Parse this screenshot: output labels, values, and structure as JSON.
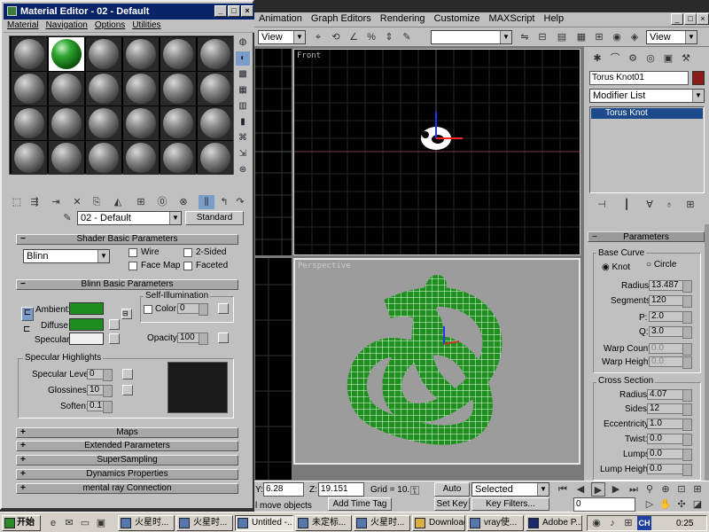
{
  "material_editor": {
    "title": "Material Editor - 02 - Default",
    "menu": [
      "Material",
      "Navigation",
      "Options",
      "Utilities"
    ],
    "material_name": "02 - Default",
    "material_type": "Standard",
    "shader_rollout": "Shader Basic Parameters",
    "shader": "Blinn",
    "wire_label": "Wire",
    "two_sided_label": "2-Sided",
    "face_map_label": "Face Map",
    "faceted_label": "Faceted",
    "blinn_rollout": "Blinn Basic Parameters",
    "self_illum_title": "Self-Illumination",
    "color_label": "Color",
    "color_value": "0",
    "ambient_label": "Ambient:",
    "diffuse_label": "Diffuse:",
    "specular_label": "Specular:",
    "opacity_label": "Opacity:",
    "opacity_value": "100",
    "spec_highlights_title": "Specular Highlights",
    "spec_level_label": "Specular Level:",
    "spec_level_value": "0",
    "glossiness_label": "Glossiness:",
    "glossiness_value": "10",
    "soften_label": "Soften:",
    "soften_value": "0.1",
    "collapsed_rollouts": [
      "Maps",
      "Extended Parameters",
      "SuperSampling",
      "Dynamics Properties",
      "mental ray Connection"
    ],
    "colors": {
      "ambient": "#1e8c1e",
      "diffuse": "#1e8c1e",
      "specular": "#f0f0f0"
    }
  },
  "max": {
    "menu": [
      "Animation",
      "Graph Editors",
      "Rendering",
      "Customize",
      "MAXScript",
      "Help"
    ],
    "view_dropdown_left": "View",
    "view_dropdown_right": "View",
    "viewport_front_label": "Front",
    "viewport_persp_label": "Perspective",
    "object_name": "Torus Knot01",
    "modifier_list": "Modifier List",
    "modifier_stack_item": "Torus Knot",
    "params_rollout": "Parameters",
    "base_curve_title": "Base Curve",
    "knot_label": "Knot",
    "circle_label": "Circle",
    "radius_label": "Radius:",
    "radius_value": "13.487",
    "segments_label": "Segments:",
    "segments_value": "120",
    "p_label": "P:",
    "p_value": "2.0",
    "q_label": "Q:",
    "q_value": "3.0",
    "warp_count_label": "Warp Count:",
    "warp_count_value": "0.0",
    "warp_height_label": "Warp Height:",
    "warp_height_value": "0.0",
    "cross_section_title": "Cross Section",
    "cs_radius_label": "Radius:",
    "cs_radius_value": "4.07",
    "sides_label": "Sides:",
    "sides_value": "12",
    "eccentricity_label": "Eccentricity:",
    "eccentricity_value": "1.0",
    "twist_label": "Twist:",
    "twist_value": "0.0",
    "lumps_label": "Lumps:",
    "lumps_value": "0.0",
    "lump_height_label": "Lump Height:",
    "lump_height_value": "0.0",
    "object_color": "#8b1a1a"
  },
  "status": {
    "y_label": "Y:",
    "y_value": "6.28",
    "z_label": "Z:",
    "z_value": "19.151",
    "grid_label": "Grid = 10.",
    "auto_key": "Auto Key",
    "selected": "Selected",
    "set_key": "Set Key",
    "key_filters": "Key Filters...",
    "add_time_tag": "Add Time Tag",
    "prompt": "l move objects",
    "frame_value": "0"
  },
  "taskbar": {
    "start": "开始",
    "tasks": [
      "火星时...",
      "火星时...",
      "Untitled -...",
      "未定标...",
      "火星时...",
      "Downloads",
      "vray使...",
      "Adobe P..."
    ],
    "clock": "0:25"
  }
}
